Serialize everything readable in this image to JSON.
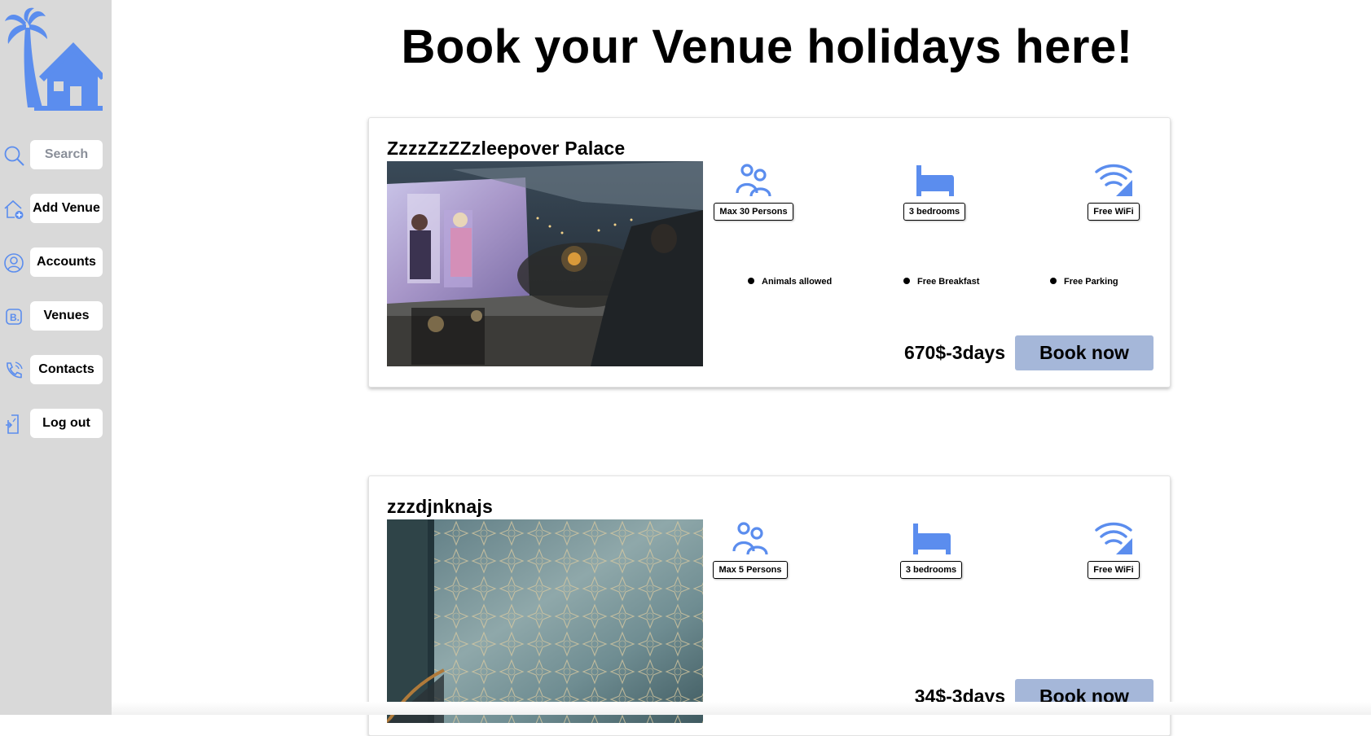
{
  "sidebar": {
    "logo_icon": "palm-house-logo",
    "search_placeholder": "Search",
    "items": [
      {
        "label": "Add Venue",
        "icon": "house-plus-icon"
      },
      {
        "label": "Accounts",
        "icon": "user-circle-icon"
      },
      {
        "label": "Venues",
        "icon": "b-badge-icon"
      },
      {
        "label": "Contacts",
        "icon": "phone-icon"
      },
      {
        "label": "Log out",
        "icon": "logout-icon"
      }
    ]
  },
  "page": {
    "title": "Book your Venue holidays here!"
  },
  "venues": [
    {
      "name": "ZzzzZzZZzleepover Palace",
      "image": "outdoor-cinema-photo",
      "capacity": "Max 30 Persons",
      "bedrooms": "3 bedrooms",
      "wifi": "Free WiFi",
      "amenities": [
        "Animals allowed",
        "Free Breakfast",
        "Free Parking"
      ],
      "price": "670$-3days",
      "book_label": "Book now"
    },
    {
      "name": "zzzdjnknajs",
      "image": "patterned-wall-stairs-photo",
      "capacity": "Max 5 Persons",
      "bedrooms": "3 bedrooms",
      "wifi": "Free WiFi",
      "amenities": [],
      "price": "34$-3days",
      "book_label": "Book now"
    }
  ],
  "colors": {
    "accent": "#5b8dee",
    "sidebar_bg": "#d9d9d9",
    "book_button": "#a5b7d9"
  }
}
